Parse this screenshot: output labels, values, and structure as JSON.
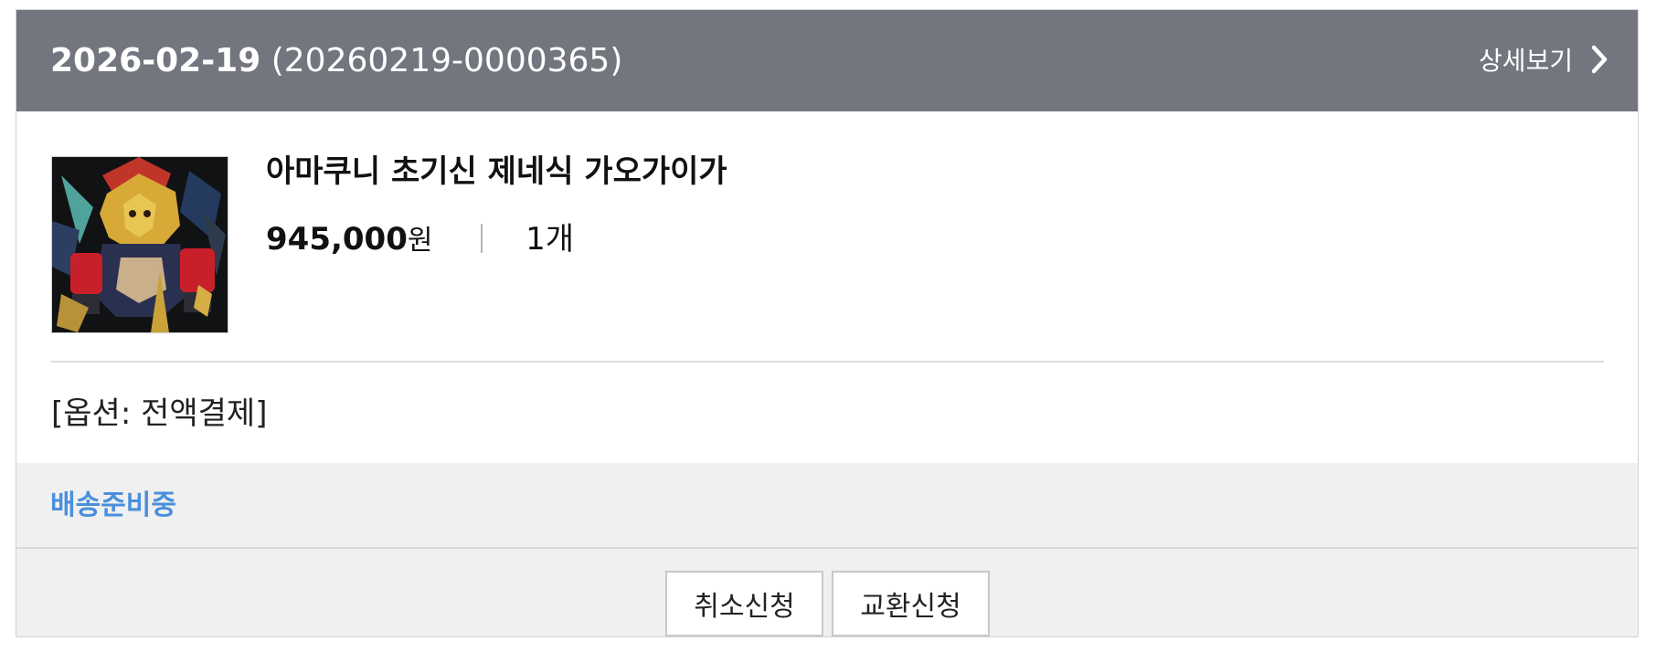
{
  "order": {
    "date": "2026-02-19",
    "order_number": "(20260219-0000365)",
    "detail_link": "상세보기"
  },
  "product": {
    "name": "아마쿠니 초기신 제네식 가오가이가",
    "price": "945,000",
    "price_unit": "원",
    "quantity": "1개",
    "option": "[옵션: 전액결제]"
  },
  "status": {
    "label": "배송준비중",
    "color": "#4a8fdc"
  },
  "actions": {
    "cancel_label": "취소신청",
    "exchange_label": "교환신청"
  },
  "colors": {
    "header_bg": "#73767f",
    "status_bg": "#f0f0f0"
  },
  "icons": {
    "detail": "chevron-right-icon"
  }
}
